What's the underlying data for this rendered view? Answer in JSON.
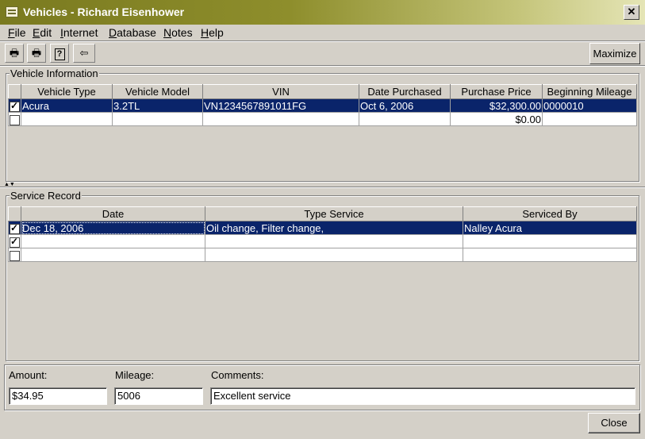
{
  "window": {
    "title": "Vehicles - Richard Eisenhower",
    "close_glyph": "✕"
  },
  "menu": [
    {
      "u": "F",
      "rest": "ile"
    },
    {
      "u": "E",
      "rest": "dit"
    },
    {
      "u": "I",
      "rest": "nternet"
    },
    {
      "u": "D",
      "rest": "atabase"
    },
    {
      "u": "N",
      "rest": "otes"
    },
    {
      "u": "H",
      "rest": "elp"
    }
  ],
  "toolbar": {
    "print_glyph": "🖶",
    "print_preview_glyph": "🖶",
    "help_glyph": "?",
    "back_glyph": "⇦",
    "maximize_label": "Maximize"
  },
  "vehicle_info": {
    "label": "Vehicle Information",
    "columns": [
      "Vehicle Type",
      "Vehicle Model",
      "VIN",
      "Date Purchased",
      "Purchase Price",
      "Beginning Mileage"
    ],
    "rows": [
      {
        "checked": true,
        "selected": true,
        "cells": [
          "Acura",
          "3.2TL",
          "VN1234567891011FG",
          "Oct 6, 2006",
          "$32,300.00",
          "0000010"
        ]
      },
      {
        "checked": false,
        "selected": false,
        "cells": [
          "",
          "",
          "",
          "",
          "$0.00",
          ""
        ]
      }
    ]
  },
  "service_record": {
    "label": "Service Record",
    "columns": [
      "Date",
      "Type Service",
      "Serviced By"
    ],
    "rows": [
      {
        "checked": true,
        "selected": true,
        "cells": [
          "Dec 18, 2006",
          "Oil change, Filter change,",
          "Nalley Acura"
        ]
      },
      {
        "checked": true,
        "selected": false,
        "cells": [
          "",
          "",
          ""
        ]
      },
      {
        "checked": false,
        "selected": false,
        "cells": [
          "",
          "",
          ""
        ]
      }
    ]
  },
  "fields": {
    "amount_label": "Amount:",
    "amount_value": "$34.95",
    "mileage_label": "Mileage:",
    "mileage_value": "5006",
    "comments_label": "Comments:",
    "comments_value": "Excellent service"
  },
  "close_label": "Close"
}
